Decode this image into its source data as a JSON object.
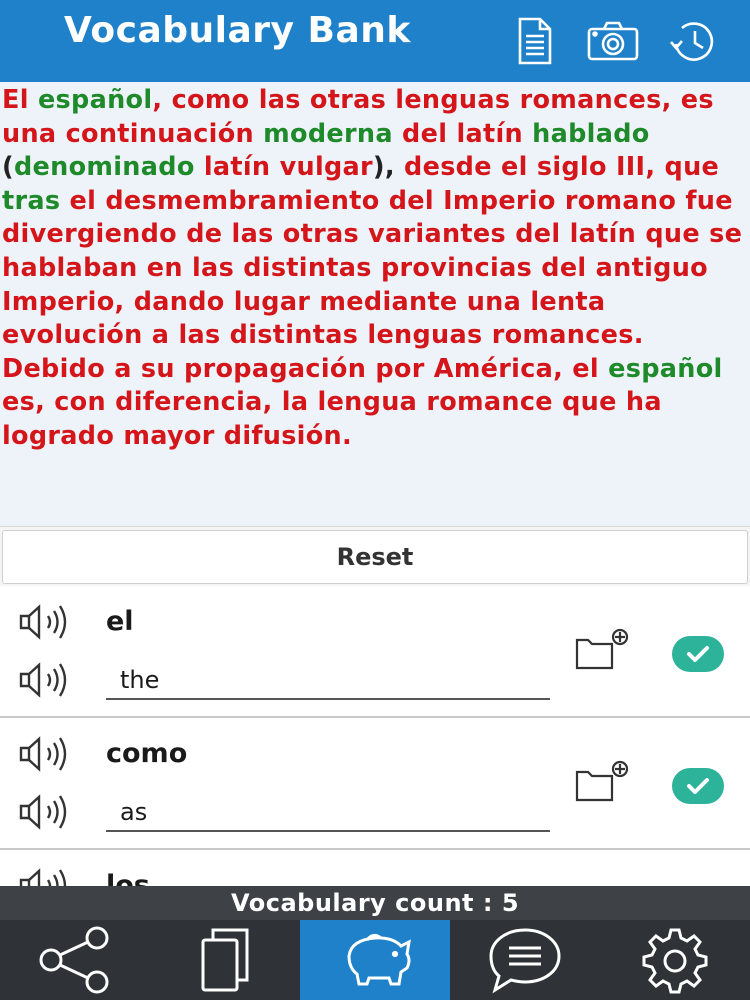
{
  "header": {
    "title": "Vocabulary Bank",
    "icons": [
      "document-icon",
      "camera-icon",
      "history-icon"
    ]
  },
  "passage": {
    "words": [
      {
        "t": "El",
        "k": false
      },
      {
        "t": " ",
        "p": true
      },
      {
        "t": "español",
        "k": true
      },
      {
        "t": ", ",
        "p": true
      },
      {
        "t": "como",
        "k": false
      },
      {
        "t": " ",
        "p": true
      },
      {
        "t": "las",
        "k": false
      },
      {
        "t": " ",
        "p": true
      },
      {
        "t": "otras",
        "k": false
      },
      {
        "t": " ",
        "p": true
      },
      {
        "t": "lenguas",
        "k": false
      },
      {
        "t": " ",
        "p": true
      },
      {
        "t": "romances",
        "k": false
      },
      {
        "t": ", ",
        "p": true
      },
      {
        "t": "es",
        "k": false
      },
      {
        "t": " ",
        "p": true
      },
      {
        "t": "una",
        "k": false
      },
      {
        "t": " ",
        "p": true
      },
      {
        "t": "continuación",
        "k": false
      },
      {
        "t": " ",
        "p": true
      },
      {
        "t": "moderna",
        "k": true
      },
      {
        "t": " ",
        "p": true
      },
      {
        "t": "del",
        "k": false
      },
      {
        "t": " ",
        "p": true
      },
      {
        "t": "latín",
        "k": false
      },
      {
        "t": " ",
        "p": true
      },
      {
        "t": "hablado",
        "k": true
      },
      {
        "t": " (",
        "p": true
      },
      {
        "t": "denominado",
        "k": true
      },
      {
        "t": " ",
        "p": true
      },
      {
        "t": "latín",
        "k": false
      },
      {
        "t": " ",
        "p": true
      },
      {
        "t": "vulgar",
        "k": false
      },
      {
        "t": "), ",
        "p": true
      },
      {
        "t": "desde",
        "k": false
      },
      {
        "t": " ",
        "p": true
      },
      {
        "t": "el",
        "k": false
      },
      {
        "t": " ",
        "p": true
      },
      {
        "t": "siglo",
        "k": false
      },
      {
        "t": " ",
        "p": true
      },
      {
        "t": "III",
        "k": false
      },
      {
        "t": ", ",
        "p": true
      },
      {
        "t": "que",
        "k": false
      },
      {
        "t": " ",
        "p": true
      },
      {
        "t": "tras",
        "k": true
      },
      {
        "t": " ",
        "p": true
      },
      {
        "t": "el",
        "k": false
      },
      {
        "t": " ",
        "p": true
      },
      {
        "t": "desmembramiento",
        "k": false
      },
      {
        "t": " ",
        "p": true
      },
      {
        "t": "del",
        "k": false
      },
      {
        "t": " ",
        "p": true
      },
      {
        "t": "Imperio",
        "k": false
      },
      {
        "t": " ",
        "p": true
      },
      {
        "t": "romano",
        "k": false
      },
      {
        "t": " ",
        "p": true
      },
      {
        "t": "fue",
        "k": false
      },
      {
        "t": " ",
        "p": true
      },
      {
        "t": "divergiendo",
        "k": false
      },
      {
        "t": " ",
        "p": true
      },
      {
        "t": "de",
        "k": false
      },
      {
        "t": " ",
        "p": true
      },
      {
        "t": "las",
        "k": false
      },
      {
        "t": " ",
        "p": true
      },
      {
        "t": "otras",
        "k": false
      },
      {
        "t": " ",
        "p": true
      },
      {
        "t": "variantes",
        "k": false
      },
      {
        "t": " ",
        "p": true
      },
      {
        "t": "del",
        "k": false
      },
      {
        "t": " ",
        "p": true
      },
      {
        "t": "latín",
        "k": false
      },
      {
        "t": " ",
        "p": true
      },
      {
        "t": "que",
        "k": false
      },
      {
        "t": " ",
        "p": true
      },
      {
        "t": "se",
        "k": false
      },
      {
        "t": " ",
        "p": true
      },
      {
        "t": "hablaban",
        "k": false
      },
      {
        "t": " ",
        "p": true
      },
      {
        "t": "en",
        "k": false
      },
      {
        "t": " ",
        "p": true
      },
      {
        "t": "las",
        "k": false
      },
      {
        "t": " ",
        "p": true
      },
      {
        "t": "distintas",
        "k": false
      },
      {
        "t": " ",
        "p": true
      },
      {
        "t": "provincias",
        "k": false
      },
      {
        "t": " ",
        "p": true
      },
      {
        "t": "del",
        "k": false
      },
      {
        "t": " ",
        "p": true
      },
      {
        "t": "antiguo",
        "k": false
      },
      {
        "t": " ",
        "p": true
      },
      {
        "t": "Imperio",
        "k": false
      },
      {
        "t": ", ",
        "p": true
      },
      {
        "t": "dando",
        "k": false
      },
      {
        "t": " ",
        "p": true
      },
      {
        "t": "lugar",
        "k": false
      },
      {
        "t": " ",
        "p": true
      },
      {
        "t": "mediante",
        "k": false
      },
      {
        "t": " ",
        "p": true
      },
      {
        "t": "una",
        "k": false
      },
      {
        "t": " ",
        "p": true
      },
      {
        "t": "lenta",
        "k": false
      },
      {
        "t": " ",
        "p": true
      },
      {
        "t": "evolución",
        "k": false
      },
      {
        "t": " ",
        "p": true
      },
      {
        "t": "a",
        "k": false
      },
      {
        "t": " ",
        "p": true
      },
      {
        "t": "las",
        "k": false
      },
      {
        "t": " ",
        "p": true
      },
      {
        "t": "distintas",
        "k": false
      },
      {
        "t": " ",
        "p": true
      },
      {
        "t": "lenguas",
        "k": false
      },
      {
        "t": " ",
        "p": true
      },
      {
        "t": "romances",
        "k": false
      },
      {
        "t": ". ",
        "p": true
      },
      {
        "t": "Debido",
        "k": false
      },
      {
        "t": " ",
        "p": true
      },
      {
        "t": "a",
        "k": false
      },
      {
        "t": " ",
        "p": true
      },
      {
        "t": "su",
        "k": false
      },
      {
        "t": " ",
        "p": true
      },
      {
        "t": "propagación",
        "k": false
      },
      {
        "t": " ",
        "p": true
      },
      {
        "t": "por",
        "k": false
      },
      {
        "t": " ",
        "p": true
      },
      {
        "t": "América",
        "k": false
      },
      {
        "t": ", ",
        "p": true
      },
      {
        "t": "el",
        "k": false
      },
      {
        "t": " ",
        "p": true
      },
      {
        "t": "español",
        "k": true
      },
      {
        "t": " ",
        "p": true
      },
      {
        "t": "es",
        "k": false
      },
      {
        "t": ", ",
        "p": true
      },
      {
        "t": "con",
        "k": false
      },
      {
        "t": " ",
        "p": true
      },
      {
        "t": "diferencia",
        "k": false
      },
      {
        "t": ", ",
        "p": true
      },
      {
        "t": "la",
        "k": false
      },
      {
        "t": " ",
        "p": true
      },
      {
        "t": "lengua",
        "k": false
      },
      {
        "t": " ",
        "p": true
      },
      {
        "t": "romance",
        "k": false
      },
      {
        "t": " ",
        "p": true
      },
      {
        "t": "que",
        "k": false
      },
      {
        "t": " ",
        "p": true
      },
      {
        "t": "ha",
        "k": false
      },
      {
        "t": " ",
        "p": true
      },
      {
        "t": "logrado",
        "k": false
      },
      {
        "t": " ",
        "p": true
      },
      {
        "t": "mayor",
        "k": false
      },
      {
        "t": " ",
        "p": true
      },
      {
        "t": "difusión",
        "k": false
      },
      {
        "t": ".",
        "p": true
      }
    ]
  },
  "reset": {
    "label": "Reset"
  },
  "vocab": {
    "items": [
      {
        "word": "el",
        "meaning": "the"
      },
      {
        "word": "como",
        "meaning": "as"
      },
      {
        "word": "los",
        "meaning": ""
      }
    ]
  },
  "footer": {
    "count_text": "Vocabulary count : 5"
  },
  "nav": {
    "items": [
      "share-icon",
      "copy-icon",
      "piggy-bank-icon",
      "chat-icon",
      "settings-icon"
    ],
    "active_index": 2
  },
  "colors": {
    "header": "#1e81c9",
    "unknown_word": "#d4161a",
    "known_word": "#1e8a2a",
    "check": "#2cb39a",
    "nav_bg": "#2f3236"
  }
}
